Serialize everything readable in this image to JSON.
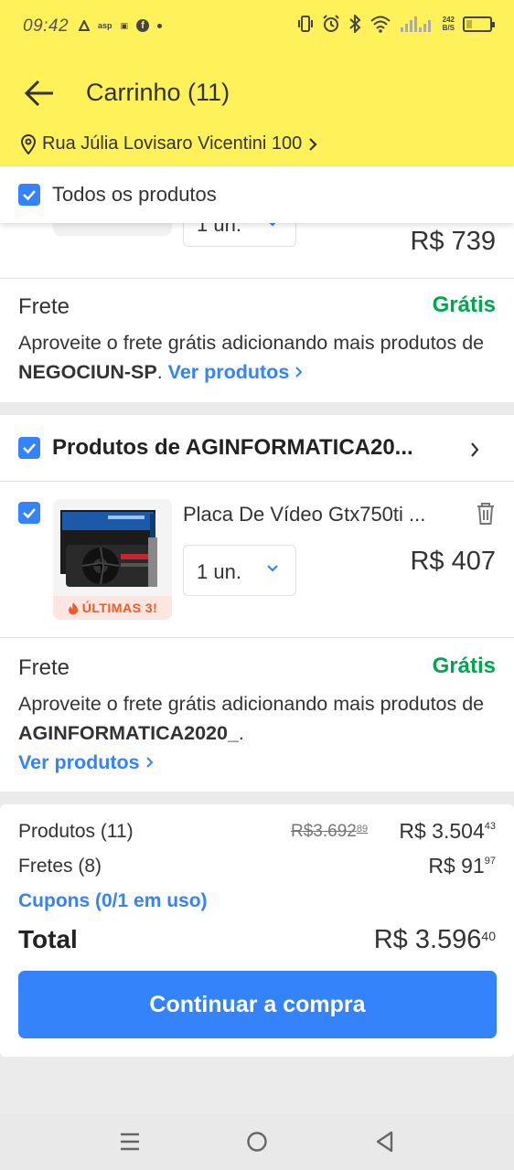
{
  "status_bar": {
    "time": "09:42",
    "mini_icons": [
      "asp",
      "▣"
    ],
    "net_speed_value": "242",
    "net_speed_unit": "B/S",
    "icons": [
      "vibrate-icon",
      "alarm-icon",
      "bluetooth-icon",
      "wifi-icon",
      "signal-icon",
      "battery-icon"
    ],
    "battery_level": 0.25
  },
  "header": {
    "title": "Carrinho (11)",
    "address": "Rua Júlia Lovisaro Vicentini 100"
  },
  "select_all": {
    "label": "Todos os produtos",
    "checked": true
  },
  "seller_1": {
    "qty": "1 un.",
    "price": "R$ 739",
    "frete_label": "Frete",
    "frete_value": "Grátis",
    "msg_prefix": "Aproveite o frete grátis adicionando mais produtos de ",
    "seller_name": "NEGOCIUN-SP",
    "msg_suffix": ". ",
    "link": "Ver produtos"
  },
  "seller_2": {
    "title": "Produtos de AGINFORMATICA20...",
    "product": {
      "title": "Placa De Vídeo Gtx750ti ...",
      "qty": "1 un.",
      "price": "R$ 407",
      "badge": "ÚLTIMAS 3!"
    },
    "frete_label": "Frete",
    "frete_value": "Grátis",
    "msg_prefix": "Aproveite o frete grátis adicionando mais produtos de ",
    "seller_name": "AGINFORMATICA2020_",
    "msg_suffix": ".",
    "link": "Ver produtos"
  },
  "summary": {
    "products_label": "Produtos (11)",
    "products_old_int": "R$3.692",
    "products_old_cents": "89",
    "products_int": "R$ 3.504",
    "products_cents": "43",
    "shipping_label": "Fretes (8)",
    "shipping_int": "R$ 91",
    "shipping_cents": "97",
    "coupons": "Cupons (0/1 em uso)",
    "total_label": "Total",
    "total_int": "R$ 3.596",
    "total_cents": "40",
    "cta": "Continuar a compra"
  },
  "colors": {
    "brand_yellow": "#fff159",
    "accent_blue": "#3483fa",
    "free_green": "#00a650",
    "badge_orange": "#f05a24"
  }
}
